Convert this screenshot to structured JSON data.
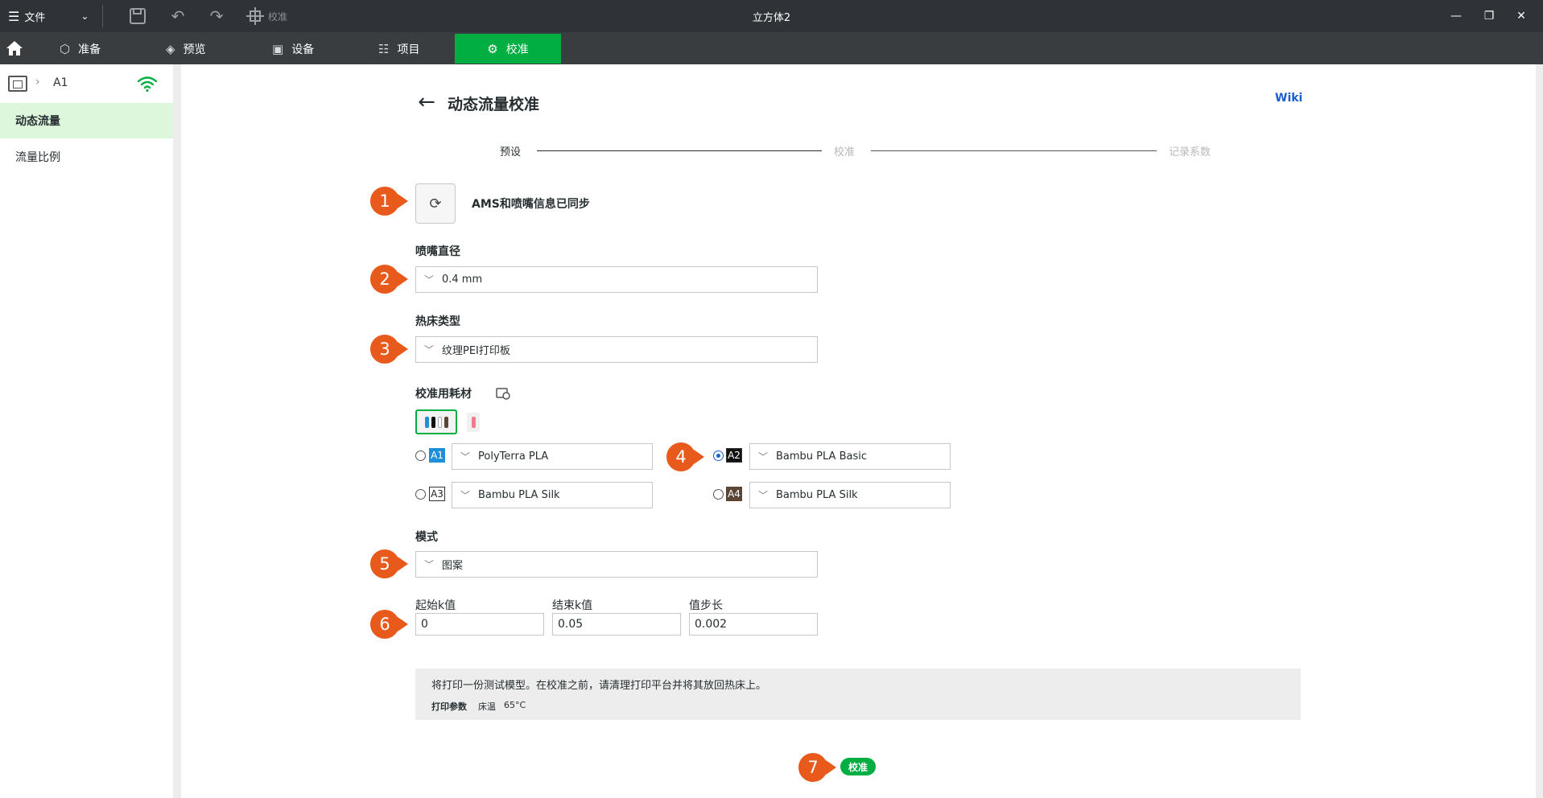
{
  "titlebar": {
    "menu_label": "文件",
    "app_title": "立方体2",
    "calibrate_tool_label": "校准"
  },
  "nav": {
    "tabs": [
      {
        "label": "准备",
        "icon": "cube-icon"
      },
      {
        "label": "预览",
        "icon": "layers-icon"
      },
      {
        "label": "设备",
        "icon": "device-icon"
      },
      {
        "label": "项目",
        "icon": "project-icon"
      },
      {
        "label": "校准",
        "icon": "calibrate-icon"
      }
    ]
  },
  "sidebar": {
    "printer_name": "A1",
    "items": [
      {
        "label": "动态流量"
      },
      {
        "label": "流量比例"
      }
    ]
  },
  "main": {
    "title": "动态流量校准",
    "wiki": "Wiki",
    "steps": [
      "预设",
      "校准",
      "记录系数"
    ],
    "sync_text": "AMS和喷嘴信息已同步",
    "nozzle_label": "喷嘴直径",
    "nozzle_value": "0.4 mm",
    "bed_label": "热床类型",
    "bed_value": "纹理PEI打印板",
    "filament_label": "校准用耗材",
    "slots": [
      {
        "slot": "A1",
        "filament": "PolyTerra PLA",
        "badge_bg": "#1e8fd8",
        "badge_fg": "#ffffff",
        "selected": false
      },
      {
        "slot": "A2",
        "filament": "Bambu PLA Basic",
        "badge_bg": "#111111",
        "badge_fg": "#ffffff",
        "selected": true
      },
      {
        "slot": "A3",
        "filament": "Bambu PLA Silk",
        "badge_bg": "#ffffff",
        "badge_fg": "#222222",
        "selected": false
      },
      {
        "slot": "A4",
        "filament": "Bambu PLA Silk",
        "badge_bg": "#5a4636",
        "badge_fg": "#ffffff",
        "selected": false
      }
    ],
    "mode_label": "模式",
    "mode_value": "图案",
    "k_start_label": "起始k值",
    "k_start": "0",
    "k_end_label": "结束k值",
    "k_end": "0.05",
    "k_step_label": "值步长",
    "k_step": "0.002",
    "info_text": "将打印一份测试模型。在校准之前，请清理打印平台并将其放回热床上。",
    "print_params_label": "打印参数",
    "bed_temp_label": "床温",
    "bed_temp_value": "65°C",
    "calibrate_button": "校准"
  },
  "markers": [
    "1",
    "2",
    "3",
    "4",
    "5",
    "6",
    "7"
  ],
  "colors": {
    "accent": "#00ae42",
    "marker": "#e85a1c",
    "link": "#1a5fd0"
  }
}
